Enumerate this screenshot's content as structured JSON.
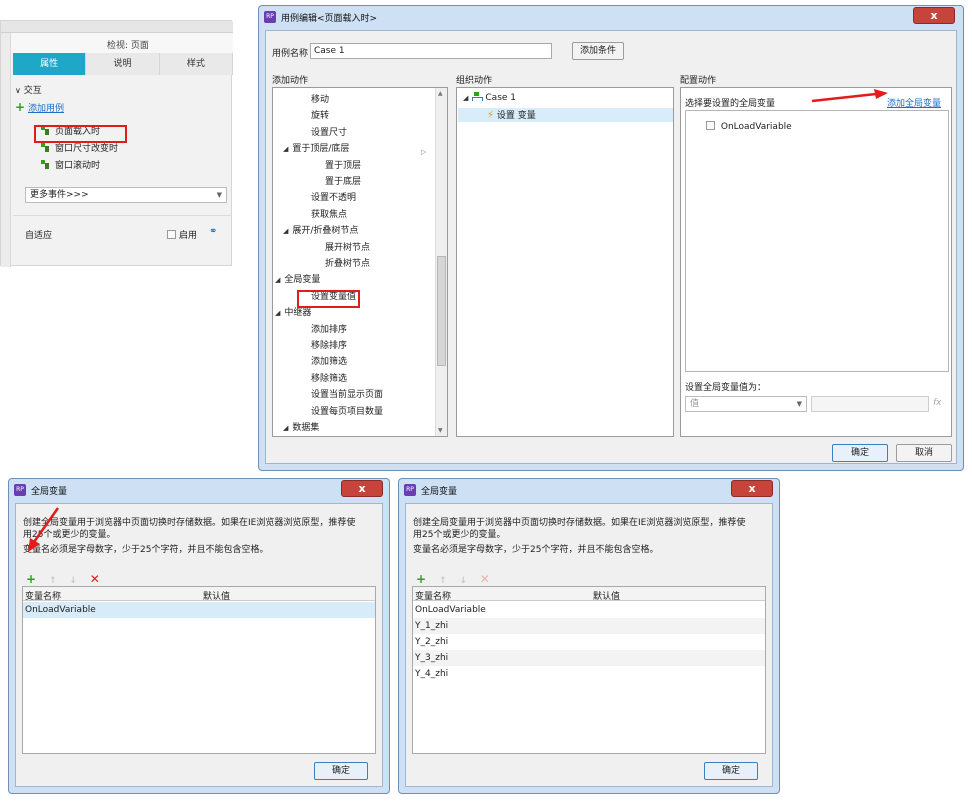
{
  "inspector": {
    "title": "检视: 页面",
    "tabs": [
      "属性",
      "说明",
      "样式"
    ],
    "interaction_header": "交互",
    "add_case": "添加用例",
    "events": [
      "页面载入时",
      "窗口尺寸改变时",
      "窗口滚动时"
    ],
    "more_events": "更多事件>>>",
    "adaptive_label": "自适应",
    "enable_label": "启用"
  },
  "main_dialog": {
    "title": "用例编辑<页面载入时>",
    "case_name_label": "用例名称",
    "case_name_value": "Case 1",
    "add_condition": "添加条件",
    "col_add_actions": "添加动作",
    "col_organize_actions": "组织动作",
    "col_configure_actions": "配置动作",
    "actions": [
      {
        "label": "移动",
        "indent": 2
      },
      {
        "label": "旋转",
        "indent": 2
      },
      {
        "label": "设置尺寸",
        "indent": 2
      },
      {
        "label": "置于顶层/底层",
        "indent": 1,
        "toggle": "◢"
      },
      {
        "label": "置于顶层",
        "indent": 3
      },
      {
        "label": "置于底层",
        "indent": 3
      },
      {
        "label": "设置不透明",
        "indent": 2
      },
      {
        "label": "获取焦点",
        "indent": 2
      },
      {
        "label": "展开/折叠树节点",
        "indent": 1,
        "toggle": "◢"
      },
      {
        "label": "展开树节点",
        "indent": 3
      },
      {
        "label": "折叠树节点",
        "indent": 3
      },
      {
        "label": "全局变量",
        "indent": 0,
        "toggle": "◢"
      },
      {
        "label": "设置变量值",
        "indent": 2
      },
      {
        "label": "中继器",
        "indent": 0,
        "toggle": "◢"
      },
      {
        "label": "添加排序",
        "indent": 2
      },
      {
        "label": "移除排序",
        "indent": 2
      },
      {
        "label": "添加筛选",
        "indent": 2
      },
      {
        "label": "移除筛选",
        "indent": 2
      },
      {
        "label": "设置当前显示页面",
        "indent": 2
      },
      {
        "label": "设置每页项目数量",
        "indent": 2
      },
      {
        "label": "数据集",
        "indent": 1,
        "toggle": "◢"
      }
    ],
    "case_tree_root": "Case 1",
    "case_tree_action": "设置 变量",
    "select_global_var_label": "选择要设置的全局变量",
    "add_global_var": "添加全局变量",
    "global_var_item": "OnLoadVariable",
    "set_value_label": "设置全局变量值为：",
    "value_type": "值",
    "fx_label": "fx",
    "ok": "确定",
    "cancel": "取消"
  },
  "var_dialog_left": {
    "title": "全局变量",
    "desc1": "创建全局变量用于浏览器中页面切换时存储数据。如果在IE浏览器浏览原型，推荐使",
    "desc2": "用25个或更少的变量。",
    "desc3": "变量名必须是字母数字，少于25个字符，并且不能包含空格。",
    "col_name": "变量名称",
    "col_default": "默认值",
    "rows": [
      "OnLoadVariable"
    ],
    "ok": "确定"
  },
  "var_dialog_right": {
    "title": "全局变量",
    "desc1": "创建全局变量用于浏览器中页面切换时存储数据。如果在IE浏览器浏览原型，推荐使",
    "desc2": "用25个或更少的变量。",
    "desc3": "变量名必须是字母数字，少于25个字符，并且不能包含空格。",
    "col_name": "变量名称",
    "col_default": "默认值",
    "rows": [
      "OnLoadVariable",
      "Y_1_zhi",
      "Y_2_zhi",
      "Y_3_zhi",
      "Y_4_zhi"
    ],
    "ok": "确定"
  },
  "colors": {
    "accent_tab": "#1fa7c8",
    "highlight_red": "#e21b1b",
    "link_blue": "#1a6fc6",
    "add_green": "#2ea11d"
  }
}
